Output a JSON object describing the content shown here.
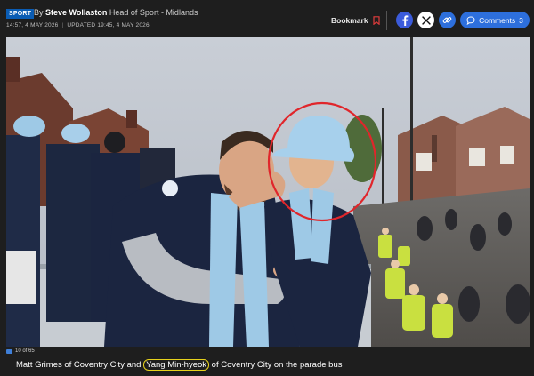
{
  "header": {
    "badge": "SPORT",
    "by": "By",
    "author": "Steve Wollaston",
    "role": "Head of Sport - Midlands",
    "published": "14:57, 4 MAY 2026",
    "updated_label": "UPDATED",
    "updated": "19:45, 4 MAY 2026",
    "bookmark_label": "Bookmark",
    "comments_label": "Comments",
    "comments_count": "3"
  },
  "icons": {
    "bookmark": "bookmark-icon",
    "facebook": "facebook-icon",
    "x": "x-icon",
    "link": "link-icon",
    "comments": "comment-bubble-icon",
    "camera": "camera-icon"
  },
  "colors": {
    "accent_blue": "#2d6fdc",
    "facebook_blue": "#3b5bdb",
    "bookmark_red": "#e03c3c",
    "highlight_ring": "#e0262b",
    "name_highlight": "#e7d21c"
  },
  "gallery": {
    "counter": "10 of 65",
    "caption_before": "Matt Grimes of Coventry City and ",
    "caption_name": "Yang Min-hyeok",
    "caption_after": " of Coventry City on the parade bus"
  }
}
